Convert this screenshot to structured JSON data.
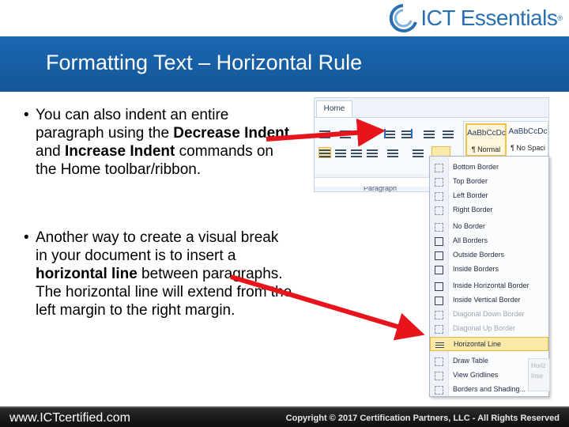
{
  "logo": {
    "text": "ICT Essentials",
    "reg": "®"
  },
  "slide": {
    "title": "Formatting Text – Horizontal Rule",
    "bullet1": {
      "a": "You can also indent an entire paragraph using the ",
      "b": "Decrease Indent",
      "c": " and ",
      "d": "Increase Indent",
      "e": " commands on the Home toolbar/ribbon."
    },
    "bullet2": {
      "a": "Another way to create a visual break in your document is to insert a ",
      "b": "horizontal line",
      "c": " between paragraphs. The horizontal line will extend from the left margin to the right margin."
    },
    "bullet_char": "•"
  },
  "ribbon": {
    "tab": "Home",
    "group_label": "Paragraph",
    "style_normal_sample": "AaBbCcDc",
    "style_normal_label": "¶ Normal",
    "style_nospace_sample": "AaBbCcDc",
    "style_nospace_label": "¶ No Spaci"
  },
  "border_menu": {
    "items": [
      {
        "label": "Bottom Border",
        "icon": "bottom-border-icon"
      },
      {
        "label": "Top Border",
        "icon": "top-border-icon"
      },
      {
        "label": "Left Border",
        "icon": "left-border-icon"
      },
      {
        "label": "Right Border",
        "icon": "right-border-icon"
      },
      {
        "label": "No Border",
        "icon": "no-border-icon"
      },
      {
        "label": "All Borders",
        "icon": "all-borders-icon"
      },
      {
        "label": "Outside Borders",
        "icon": "outside-borders-icon"
      },
      {
        "label": "Inside Borders",
        "icon": "inside-borders-icon"
      },
      {
        "label": "Inside Horizontal Border",
        "icon": "inside-horizontal-border-icon"
      },
      {
        "label": "Inside Vertical Border",
        "icon": "inside-vertical-border-icon"
      },
      {
        "label": "Diagonal Down Border",
        "icon": "diagonal-down-border-icon"
      },
      {
        "label": "Diagonal Up Border",
        "icon": "diagonal-up-border-icon"
      },
      {
        "label": "Horizontal Line",
        "icon": "horizontal-line-icon"
      },
      {
        "label": "Draw Table",
        "icon": "draw-table-icon"
      },
      {
        "label": "View Gridlines",
        "icon": "view-gridlines-icon"
      },
      {
        "label": "Borders and Shading...",
        "icon": "borders-shading-icon"
      }
    ],
    "flyout_1": "Horiz",
    "flyout_2": "Inse"
  },
  "footer": {
    "url": "www.ICTcertified.com",
    "copyright": "Copyright © 2017 Certification Partners, LLC - All Rights Reserved"
  },
  "colors": {
    "title_band": "#1b66b2",
    "arrow": "#e8141b",
    "highlight": "#fde9a8"
  }
}
